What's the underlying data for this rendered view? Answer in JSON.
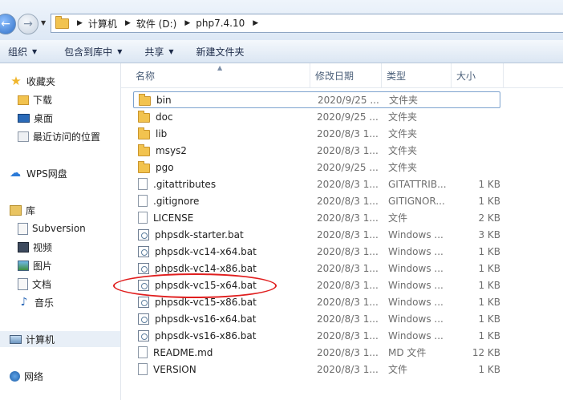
{
  "address_bar": {
    "breadcrumbs": [
      "计算机",
      "软件 (D:)",
      "php7.4.10"
    ]
  },
  "toolbar": {
    "organize": "组织",
    "include_in_library": "包含到库中",
    "share": "共享",
    "new_folder": "新建文件夹"
  },
  "nav": {
    "favorites": "收藏夹",
    "downloads": "下载",
    "desktop": "桌面",
    "recent": "最近访问的位置",
    "wps": "WPS网盘",
    "libraries": "库",
    "subversion": "Subversion",
    "videos": "视频",
    "pictures": "图片",
    "documents": "文档",
    "music": "音乐",
    "computer": "计算机",
    "network": "网络"
  },
  "columns": {
    "name": "名称",
    "date": "修改日期",
    "type": "类型",
    "size": "大小"
  },
  "files": [
    {
      "name": "bin",
      "date": "2020/9/25 ...",
      "type": "文件夹",
      "size": "",
      "icon": "folder-icon"
    },
    {
      "name": "doc",
      "date": "2020/9/25 ...",
      "type": "文件夹",
      "size": "",
      "icon": "folder-icon"
    },
    {
      "name": "lib",
      "date": "2020/8/3 1...",
      "type": "文件夹",
      "size": "",
      "icon": "folder-icon"
    },
    {
      "name": "msys2",
      "date": "2020/8/3 1...",
      "type": "文件夹",
      "size": "",
      "icon": "folder-icon"
    },
    {
      "name": "pgo",
      "date": "2020/9/25 ...",
      "type": "文件夹",
      "size": "",
      "icon": "folder-icon"
    },
    {
      "name": ".gitattributes",
      "date": "2020/8/3 1...",
      "type": "GITATTRIB...",
      "size": "1 KB",
      "icon": "file-icon"
    },
    {
      "name": ".gitignore",
      "date": "2020/8/3 1...",
      "type": "GITIGNOR...",
      "size": "1 KB",
      "icon": "file-icon"
    },
    {
      "name": "LICENSE",
      "date": "2020/8/3 1...",
      "type": "文件",
      "size": "2 KB",
      "icon": "file-icon"
    },
    {
      "name": "phpsdk-starter.bat",
      "date": "2020/8/3 1...",
      "type": "Windows ...",
      "size": "3 KB",
      "icon": "batch-file-icon"
    },
    {
      "name": "phpsdk-vc14-x64.bat",
      "date": "2020/8/3 1...",
      "type": "Windows ...",
      "size": "1 KB",
      "icon": "batch-file-icon"
    },
    {
      "name": "phpsdk-vc14-x86.bat",
      "date": "2020/8/3 1...",
      "type": "Windows ...",
      "size": "1 KB",
      "icon": "batch-file-icon"
    },
    {
      "name": "phpsdk-vc15-x64.bat",
      "date": "2020/8/3 1...",
      "type": "Windows ...",
      "size": "1 KB",
      "icon": "batch-file-icon"
    },
    {
      "name": "phpsdk-vc15-x86.bat",
      "date": "2020/8/3 1...",
      "type": "Windows ...",
      "size": "1 KB",
      "icon": "batch-file-icon"
    },
    {
      "name": "phpsdk-vs16-x64.bat",
      "date": "2020/8/3 1...",
      "type": "Windows ...",
      "size": "1 KB",
      "icon": "batch-file-icon"
    },
    {
      "name": "phpsdk-vs16-x86.bat",
      "date": "2020/8/3 1...",
      "type": "Windows ...",
      "size": "1 KB",
      "icon": "batch-file-icon"
    },
    {
      "name": "README.md",
      "date": "2020/8/3 1...",
      "type": "MD 文件",
      "size": "12 KB",
      "icon": "file-icon"
    },
    {
      "name": "VERSION",
      "date": "2020/8/3 1...",
      "type": "文件",
      "size": "1 KB",
      "icon": "file-icon"
    }
  ],
  "colors": {
    "annotation_circle": "#e01e1e",
    "accent": "#2e6fc6"
  }
}
